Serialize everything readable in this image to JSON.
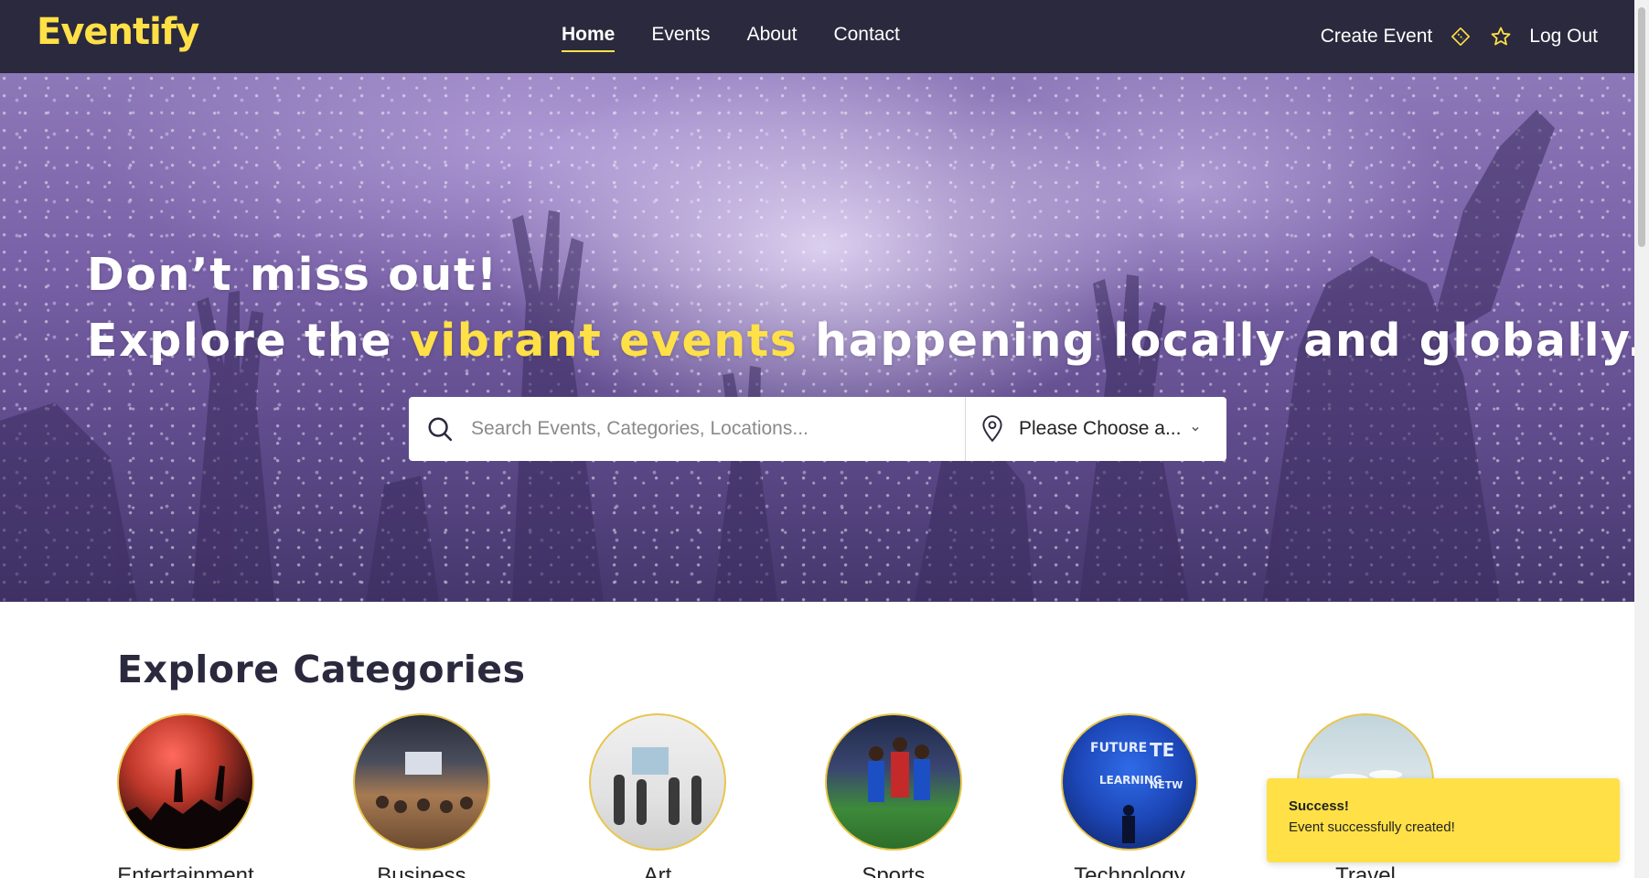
{
  "brand": {
    "logo": "Eventify"
  },
  "nav": {
    "links": [
      {
        "label": "Home",
        "active": true
      },
      {
        "label": "Events",
        "active": false
      },
      {
        "label": "About",
        "active": false
      },
      {
        "label": "Contact",
        "active": false
      }
    ],
    "create_event": "Create Event",
    "ticket_icon": "ticket-icon",
    "star_icon": "star-icon",
    "logout": "Log Out"
  },
  "hero": {
    "line1": "Don’t miss out!",
    "line2_before": "Explore the ",
    "line2_highlight": "vibrant events",
    "line2_after": " happening locally and globally."
  },
  "search": {
    "placeholder": "Search Events, Categories, Locations...",
    "location_value": "Please Choose a...",
    "search_icon": "search-icon",
    "location_icon": "map-pin-icon"
  },
  "categories": {
    "title": "Explore Categories",
    "items": [
      {
        "label": "Entertainment"
      },
      {
        "label": "Business"
      },
      {
        "label": "Art"
      },
      {
        "label": "Sports"
      },
      {
        "label": "Technology"
      },
      {
        "label": "Travel"
      }
    ]
  },
  "toast": {
    "title": "Success!",
    "message": "Event successfully created!"
  },
  "colors": {
    "navbar": "#2b293d",
    "accent": "#ffe047",
    "hero_text": "#ffffff"
  }
}
